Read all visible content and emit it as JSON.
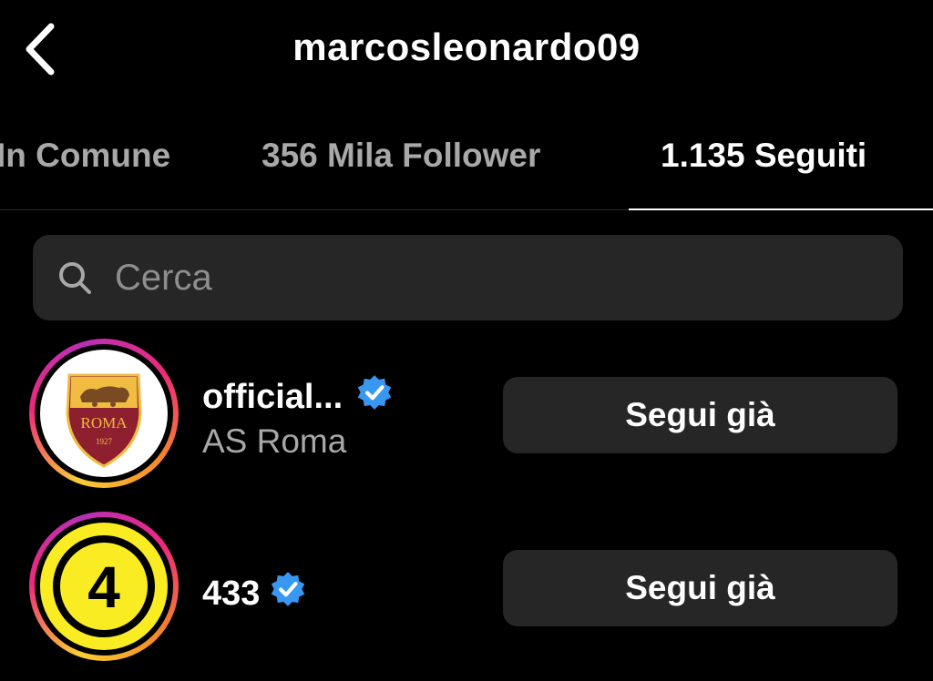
{
  "header": {
    "username": "marcosleonardo09",
    "back_icon": "chevron-left-icon"
  },
  "tabs": [
    {
      "label": "In Comune",
      "active": false
    },
    {
      "label": "356 Mila Follower",
      "active": false
    },
    {
      "label": "1.135 Seguiti",
      "active": true
    }
  ],
  "search": {
    "placeholder": "Cerca",
    "value": "",
    "icon": "search-icon"
  },
  "accounts": [
    {
      "username": "official...",
      "full_name": "AS Roma",
      "verified": true,
      "button_label": "Segui già",
      "avatar_text": "ROMA",
      "avatar_year": "1927"
    },
    {
      "username": "433",
      "full_name": "",
      "verified": true,
      "button_label": "Segui già",
      "avatar_text": "4"
    }
  ],
  "colors": {
    "background": "#000000",
    "button_bg": "#262626",
    "verified_blue": "#3897f0",
    "muted_text": "#a8a8a8"
  }
}
